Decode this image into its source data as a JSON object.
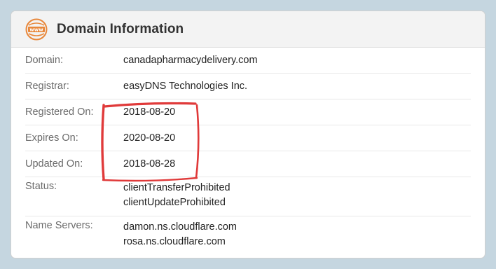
{
  "panel": {
    "title": "Domain Information",
    "icon": "www-icon",
    "icon_text": "www",
    "accent_color": "#e8873a"
  },
  "rows": [
    {
      "label": "Domain:",
      "values": [
        "canadapharmacydelivery.com"
      ]
    },
    {
      "label": "Registrar:",
      "values": [
        "easyDNS Technologies Inc."
      ]
    },
    {
      "label": "Registered On:",
      "values": [
        "2018-08-20"
      ]
    },
    {
      "label": "Expires On:",
      "values": [
        "2020-08-20"
      ]
    },
    {
      "label": "Updated On:",
      "values": [
        "2018-08-28"
      ]
    },
    {
      "label": "Status:",
      "values": [
        "clientTransferProhibited",
        "clientUpdateProhibited"
      ]
    },
    {
      "label": "Name Servers:",
      "values": [
        "damon.ns.cloudflare.com",
        "rosa.ns.cloudflare.com"
      ]
    }
  ],
  "annotation": {
    "color": "#e03a3a"
  }
}
